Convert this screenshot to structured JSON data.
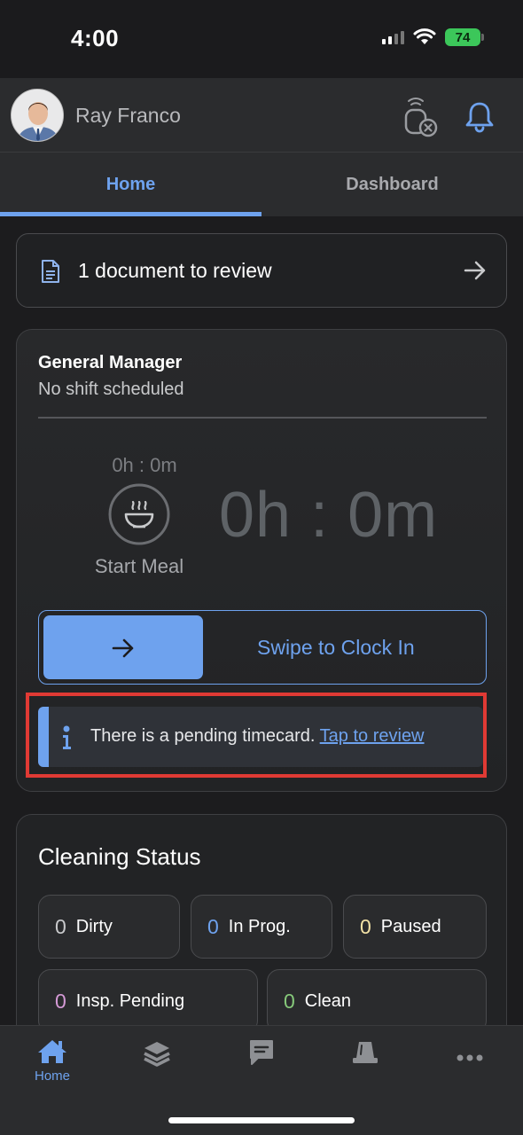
{
  "status_bar": {
    "time": "4:00",
    "battery": "74"
  },
  "header": {
    "user_name": "Ray Franco"
  },
  "tabs": [
    {
      "label": "Home",
      "active": true
    },
    {
      "label": "Dashboard",
      "active": false
    }
  ],
  "documents": {
    "label": "1 document to review"
  },
  "shift": {
    "job_title": "General Manager",
    "status": "No shift scheduled",
    "meal_time": "0h : 0m",
    "meal_label": "Start Meal",
    "total_time": "0h : 0m",
    "swipe_label": "Swipe to Clock In",
    "notice_text": "There is a pending timecard.",
    "notice_link": "Tap to review"
  },
  "cleaning_status": {
    "title": "Cleaning Status",
    "items": [
      {
        "count": "0",
        "label": "Dirty",
        "color": "#c9cacc"
      },
      {
        "count": "0",
        "label": "In Prog.",
        "color": "#6ea2ee"
      },
      {
        "count": "0",
        "label": "Paused",
        "color": "#f3e2a6"
      },
      {
        "count": "0",
        "label": "Insp. Pending",
        "color": "#d59ad6"
      },
      {
        "count": "0",
        "label": "Clean",
        "color": "#86c97a"
      }
    ]
  },
  "bottom_nav": {
    "items": [
      {
        "icon": "home-icon",
        "label": "Home",
        "active": true
      },
      {
        "icon": "layers-icon",
        "label": "",
        "active": false
      },
      {
        "icon": "chat-icon",
        "label": "",
        "active": false
      },
      {
        "icon": "alert-light-icon",
        "label": "",
        "active": false
      },
      {
        "icon": "more-icon",
        "label": "",
        "active": false
      }
    ]
  },
  "colors": {
    "accent": "#6ea2ee",
    "highlight_outline": "#e03a34",
    "background": "#1c1c1e"
  }
}
